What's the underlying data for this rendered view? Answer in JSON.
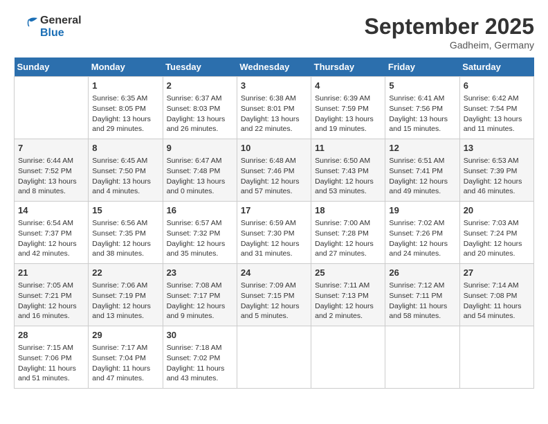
{
  "header": {
    "logo_text_general": "General",
    "logo_text_blue": "Blue",
    "month_title": "September 2025",
    "location": "Gadheim, Germany"
  },
  "days_of_week": [
    "Sunday",
    "Monday",
    "Tuesday",
    "Wednesday",
    "Thursday",
    "Friday",
    "Saturday"
  ],
  "weeks": [
    [
      {
        "day": "",
        "info": ""
      },
      {
        "day": "1",
        "info": "Sunrise: 6:35 AM\nSunset: 8:05 PM\nDaylight: 13 hours\nand 29 minutes."
      },
      {
        "day": "2",
        "info": "Sunrise: 6:37 AM\nSunset: 8:03 PM\nDaylight: 13 hours\nand 26 minutes."
      },
      {
        "day": "3",
        "info": "Sunrise: 6:38 AM\nSunset: 8:01 PM\nDaylight: 13 hours\nand 22 minutes."
      },
      {
        "day": "4",
        "info": "Sunrise: 6:39 AM\nSunset: 7:59 PM\nDaylight: 13 hours\nand 19 minutes."
      },
      {
        "day": "5",
        "info": "Sunrise: 6:41 AM\nSunset: 7:56 PM\nDaylight: 13 hours\nand 15 minutes."
      },
      {
        "day": "6",
        "info": "Sunrise: 6:42 AM\nSunset: 7:54 PM\nDaylight: 13 hours\nand 11 minutes."
      }
    ],
    [
      {
        "day": "7",
        "info": "Sunrise: 6:44 AM\nSunset: 7:52 PM\nDaylight: 13 hours\nand 8 minutes."
      },
      {
        "day": "8",
        "info": "Sunrise: 6:45 AM\nSunset: 7:50 PM\nDaylight: 13 hours\nand 4 minutes."
      },
      {
        "day": "9",
        "info": "Sunrise: 6:47 AM\nSunset: 7:48 PM\nDaylight: 13 hours\nand 0 minutes."
      },
      {
        "day": "10",
        "info": "Sunrise: 6:48 AM\nSunset: 7:46 PM\nDaylight: 12 hours\nand 57 minutes."
      },
      {
        "day": "11",
        "info": "Sunrise: 6:50 AM\nSunset: 7:43 PM\nDaylight: 12 hours\nand 53 minutes."
      },
      {
        "day": "12",
        "info": "Sunrise: 6:51 AM\nSunset: 7:41 PM\nDaylight: 12 hours\nand 49 minutes."
      },
      {
        "day": "13",
        "info": "Sunrise: 6:53 AM\nSunset: 7:39 PM\nDaylight: 12 hours\nand 46 minutes."
      }
    ],
    [
      {
        "day": "14",
        "info": "Sunrise: 6:54 AM\nSunset: 7:37 PM\nDaylight: 12 hours\nand 42 minutes."
      },
      {
        "day": "15",
        "info": "Sunrise: 6:56 AM\nSunset: 7:35 PM\nDaylight: 12 hours\nand 38 minutes."
      },
      {
        "day": "16",
        "info": "Sunrise: 6:57 AM\nSunset: 7:32 PM\nDaylight: 12 hours\nand 35 minutes."
      },
      {
        "day": "17",
        "info": "Sunrise: 6:59 AM\nSunset: 7:30 PM\nDaylight: 12 hours\nand 31 minutes."
      },
      {
        "day": "18",
        "info": "Sunrise: 7:00 AM\nSunset: 7:28 PM\nDaylight: 12 hours\nand 27 minutes."
      },
      {
        "day": "19",
        "info": "Sunrise: 7:02 AM\nSunset: 7:26 PM\nDaylight: 12 hours\nand 24 minutes."
      },
      {
        "day": "20",
        "info": "Sunrise: 7:03 AM\nSunset: 7:24 PM\nDaylight: 12 hours\nand 20 minutes."
      }
    ],
    [
      {
        "day": "21",
        "info": "Sunrise: 7:05 AM\nSunset: 7:21 PM\nDaylight: 12 hours\nand 16 minutes."
      },
      {
        "day": "22",
        "info": "Sunrise: 7:06 AM\nSunset: 7:19 PM\nDaylight: 12 hours\nand 13 minutes."
      },
      {
        "day": "23",
        "info": "Sunrise: 7:08 AM\nSunset: 7:17 PM\nDaylight: 12 hours\nand 9 minutes."
      },
      {
        "day": "24",
        "info": "Sunrise: 7:09 AM\nSunset: 7:15 PM\nDaylight: 12 hours\nand 5 minutes."
      },
      {
        "day": "25",
        "info": "Sunrise: 7:11 AM\nSunset: 7:13 PM\nDaylight: 12 hours\nand 2 minutes."
      },
      {
        "day": "26",
        "info": "Sunrise: 7:12 AM\nSunset: 7:11 PM\nDaylight: 11 hours\nand 58 minutes."
      },
      {
        "day": "27",
        "info": "Sunrise: 7:14 AM\nSunset: 7:08 PM\nDaylight: 11 hours\nand 54 minutes."
      }
    ],
    [
      {
        "day": "28",
        "info": "Sunrise: 7:15 AM\nSunset: 7:06 PM\nDaylight: 11 hours\nand 51 minutes."
      },
      {
        "day": "29",
        "info": "Sunrise: 7:17 AM\nSunset: 7:04 PM\nDaylight: 11 hours\nand 47 minutes."
      },
      {
        "day": "30",
        "info": "Sunrise: 7:18 AM\nSunset: 7:02 PM\nDaylight: 11 hours\nand 43 minutes."
      },
      {
        "day": "",
        "info": ""
      },
      {
        "day": "",
        "info": ""
      },
      {
        "day": "",
        "info": ""
      },
      {
        "day": "",
        "info": ""
      }
    ]
  ]
}
